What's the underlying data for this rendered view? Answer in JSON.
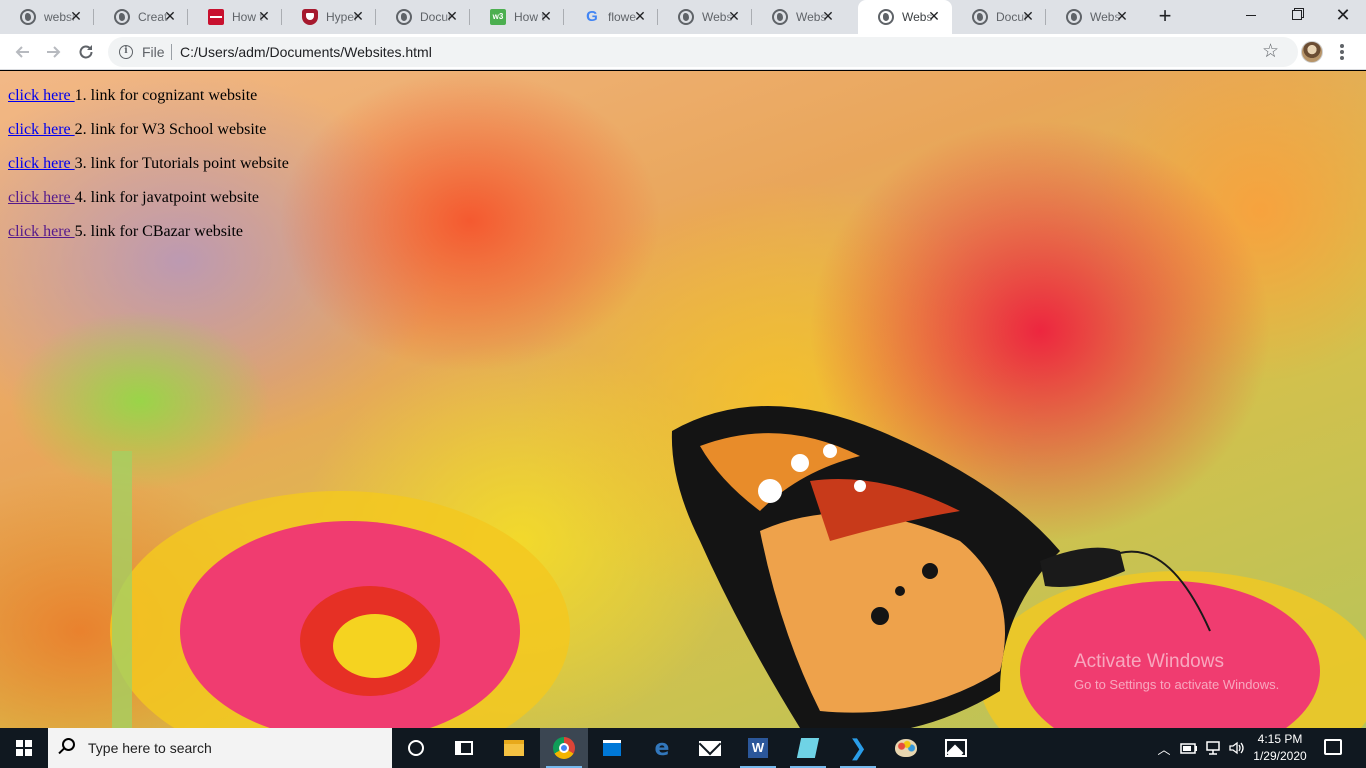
{
  "browser": {
    "tabs": [
      {
        "title": "websi",
        "icon": "globe-icon"
      },
      {
        "title": "Creat",
        "icon": "globe-icon"
      },
      {
        "title": "How t",
        "icon": "red-logo-icon"
      },
      {
        "title": "Hyper",
        "icon": "shield-icon"
      },
      {
        "title": "Docur",
        "icon": "globe-icon"
      },
      {
        "title": "How t",
        "icon": "w3schools-icon"
      },
      {
        "title": "flowe",
        "icon": "google-icon"
      },
      {
        "title": "Webs",
        "icon": "globe-icon"
      },
      {
        "title": "Webs",
        "icon": "globe-icon"
      },
      {
        "title": "Webs",
        "icon": "globe-icon",
        "active": true
      },
      {
        "title": "Docur",
        "icon": "globe-icon"
      },
      {
        "title": "Webs",
        "icon": "globe-icon"
      }
    ],
    "w3_badge": "w3",
    "google_badge": "G",
    "new_tab": "+",
    "close_glyph": "✕",
    "scheme_label": "File",
    "url": "C:/Users/adm/Documents/Websites.html"
  },
  "page": {
    "links": [
      {
        "link_text": "click here ",
        "text": "1. link for cognizant website",
        "visited": false
      },
      {
        "link_text": "click here ",
        "text": "2. link for W3 School website",
        "visited": false
      },
      {
        "link_text": "click here ",
        "text": "3. link for Tutorials point website",
        "visited": false
      },
      {
        "link_text": "click here ",
        "text": "4. link for javatpoint website",
        "visited": true
      },
      {
        "link_text": "click here ",
        "text": "5. link for CBazar website",
        "visited": true
      }
    ],
    "watermark_title": "Activate Windows",
    "watermark_subtitle": "Go to Settings to activate Windows."
  },
  "taskbar": {
    "search_placeholder": "Type here to search",
    "word_letter": "W",
    "time": "4:15 PM",
    "date": "1/29/2020"
  },
  "colors": {
    "link": "#0000ee",
    "visited_link": "#551a8b",
    "taskbar": "#101820",
    "tabstrip": "#dee1e6"
  }
}
